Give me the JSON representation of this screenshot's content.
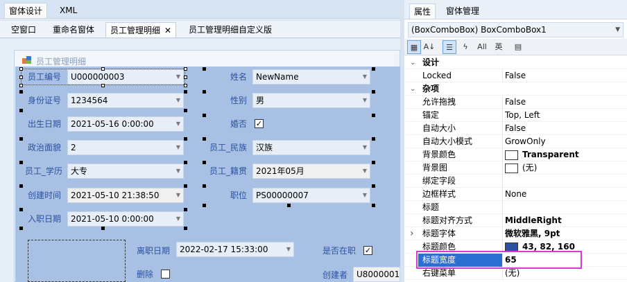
{
  "main_tabs": [
    {
      "label": "窗体设计"
    },
    {
      "label": "XML"
    }
  ],
  "doc_tabs": [
    {
      "label": "空窗口"
    },
    {
      "label": "重命名窗体"
    },
    {
      "label": "员工管理明细"
    },
    {
      "label": "员工管理明细自定义版"
    }
  ],
  "form": {
    "title": "员工管理明细",
    "fields": [
      {
        "label": "员工编号",
        "value": "U000000003"
      },
      {
        "label": "身份证号",
        "value": "1234564"
      },
      {
        "label": "出生日期",
        "value": "2021-05-16 0:00:00"
      },
      {
        "label": "政治面貌",
        "value": "2"
      },
      {
        "label": "员工_学历",
        "value": "大专"
      },
      {
        "label": "创建时间",
        "value": "2021-05-10 21:38:50"
      },
      {
        "label": "入职日期",
        "value": "2021-05-10 0:00:00"
      }
    ],
    "right_fields": [
      {
        "label": "姓名",
        "value": "NewName"
      },
      {
        "label": "性别",
        "value": "男"
      },
      {
        "label": "婚否",
        "value": "✓"
      },
      {
        "label": "员工_民族",
        "value": "汉族"
      },
      {
        "label": "员工_籍贯",
        "value": "2021年05月"
      },
      {
        "label": "职位",
        "value": "PS00000007"
      }
    ],
    "lower": {
      "leave_label": "离职日期",
      "leave_value": "2022-02-17 15:33:00",
      "active_label": "是否在职",
      "active_check": "✓",
      "delete_label": "删除",
      "creator_label": "创建者",
      "creator_value": "U8000001"
    },
    "colors": {
      "label": "#2b52a0",
      "panel": "#a7c0e3"
    }
  },
  "right_panel": {
    "tabs": [
      {
        "label": "属性"
      },
      {
        "label": "窗体管理"
      }
    ],
    "object_selector": "(BoxComboBox) BoxComboBox1",
    "toolbar": [
      {
        "icon": "categorized-icon"
      },
      {
        "icon": "alphabetical-icon"
      },
      {
        "icon": "properties-icon"
      },
      {
        "icon": "events-icon"
      },
      {
        "label": "All"
      },
      {
        "label": "英"
      },
      {
        "icon": "property-pages-icon"
      }
    ],
    "rows": [
      {
        "type": "category",
        "name": "设计"
      },
      {
        "name": "Locked",
        "value": "False"
      },
      {
        "type": "category",
        "name": "杂项"
      },
      {
        "name": "允许拖拽",
        "value": "False"
      },
      {
        "name": "锚定",
        "value": "Top, Left"
      },
      {
        "name": "自动大小",
        "value": "False"
      },
      {
        "name": "自动大小模式",
        "value": "GrowOnly"
      },
      {
        "name": "背景颜色",
        "value": "Transparent",
        "swatch": "#ffffff",
        "bold": true
      },
      {
        "name": "背景图",
        "value": "(无)",
        "swatch": "#ffffff"
      },
      {
        "name": "绑定字段",
        "value": ""
      },
      {
        "name": "边框样式",
        "value": "None"
      },
      {
        "name": "标题",
        "value": ""
      },
      {
        "name": "标题对齐方式",
        "value": "MiddleRight",
        "bold": true
      },
      {
        "name": "标题字体",
        "value": "微软雅黑, 9pt",
        "bold": true,
        "expand": true
      },
      {
        "name": "标题颜色",
        "value": "43, 82, 160",
        "swatch": "#2b52a0",
        "bold": true
      },
      {
        "name": "标题宽度",
        "value": "65",
        "bold": true,
        "selected": true
      },
      {
        "name": "右键菜单",
        "value": "(无)"
      }
    ],
    "highlight_color": "#d43ad4"
  }
}
